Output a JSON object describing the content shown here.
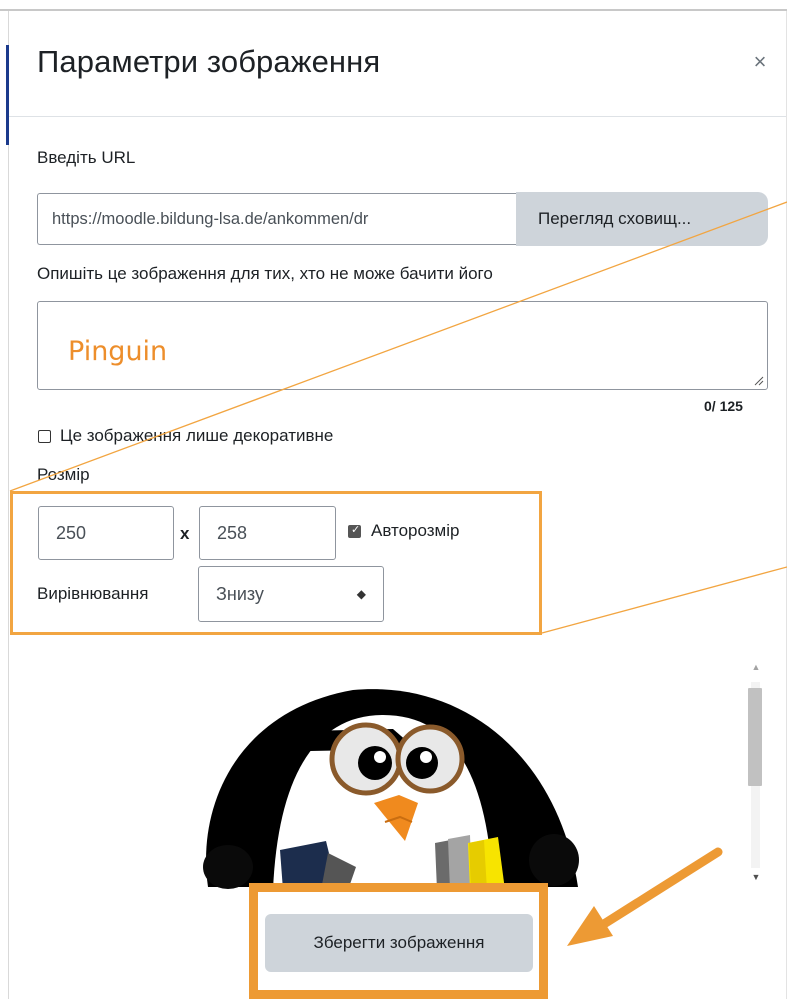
{
  "dialog": {
    "title": "Параметри зображення",
    "close_symbol": "×"
  },
  "url_field": {
    "label": "Введіть URL",
    "value": "https://moodle.bildung-lsa.de/ankommen/dr",
    "browse_button": "Перегляд сховищ..."
  },
  "alt_field": {
    "label": "Опишіть це зображення для тих, хто не може бачити його",
    "value": "Pinguin",
    "counter": "0/ 125"
  },
  "decorative": {
    "label": "Це зображення лише декоративне",
    "checked": false
  },
  "size": {
    "label": "Розмір",
    "width": "250",
    "separator": "x",
    "height": "258",
    "auto_label": "Авторозмір",
    "auto_checked": true
  },
  "alignment": {
    "label": "Вирівнювання",
    "selected": "Знизу"
  },
  "preview": {
    "image_icon": "penguin-with-glasses-and-books"
  },
  "footer": {
    "save_button": "Зберегти зображення"
  },
  "colors": {
    "annotation_orange": "#ED9A34",
    "button_gray": "#CED4DA",
    "alt_text_orange": "#ED8E2B"
  }
}
